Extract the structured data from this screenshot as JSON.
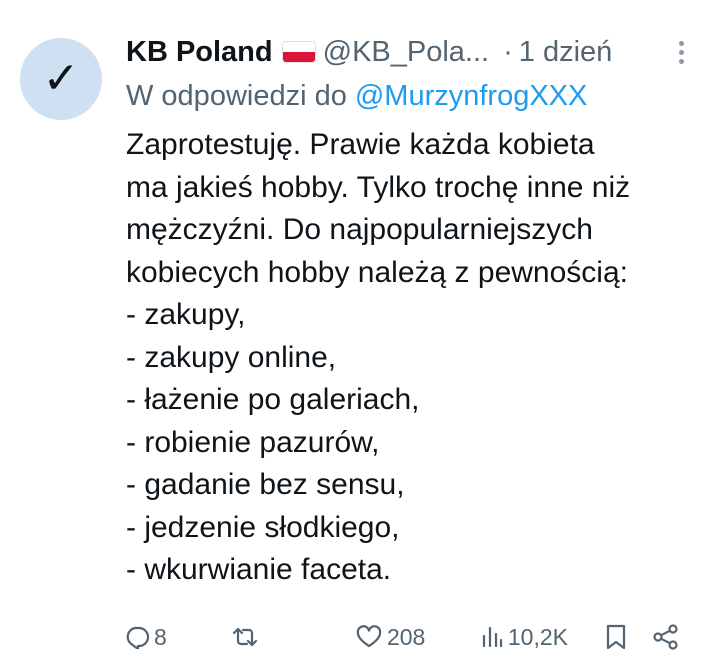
{
  "tweet": {
    "avatar_symbol": "✓",
    "display_name": "KB Poland",
    "flag": "poland-flag",
    "handle": "@KB_Pola...",
    "separator": "·",
    "time": "1 dzień",
    "reply_prefix": "W odpowiedzi do",
    "reply_to": "@MurzynfrogXXX",
    "lines": [
      "Zaprotestuję. Prawie każda kobieta",
      "ma jakieś hobby. Tylko trochę inne niż",
      "mężczyźni. Do najpopularniejszych",
      "kobiecych hobby należą z pewnością:",
      "- zakupy,",
      "- zakupy online,",
      "- łażenie po galeriach,",
      "- robienie pazurów,",
      "- gadanie bez sensu,",
      "- jedzenie słodkiego,",
      "- wkurwianie faceta."
    ]
  },
  "actions": {
    "reply_count": "8",
    "retweet_count": "",
    "like_count": "208",
    "views_count": "10,2K"
  },
  "colors": {
    "text": "#0f1419",
    "secondary": "#536471",
    "link": "#1d9bf0",
    "avatar_bg": "#cfe0f3"
  }
}
